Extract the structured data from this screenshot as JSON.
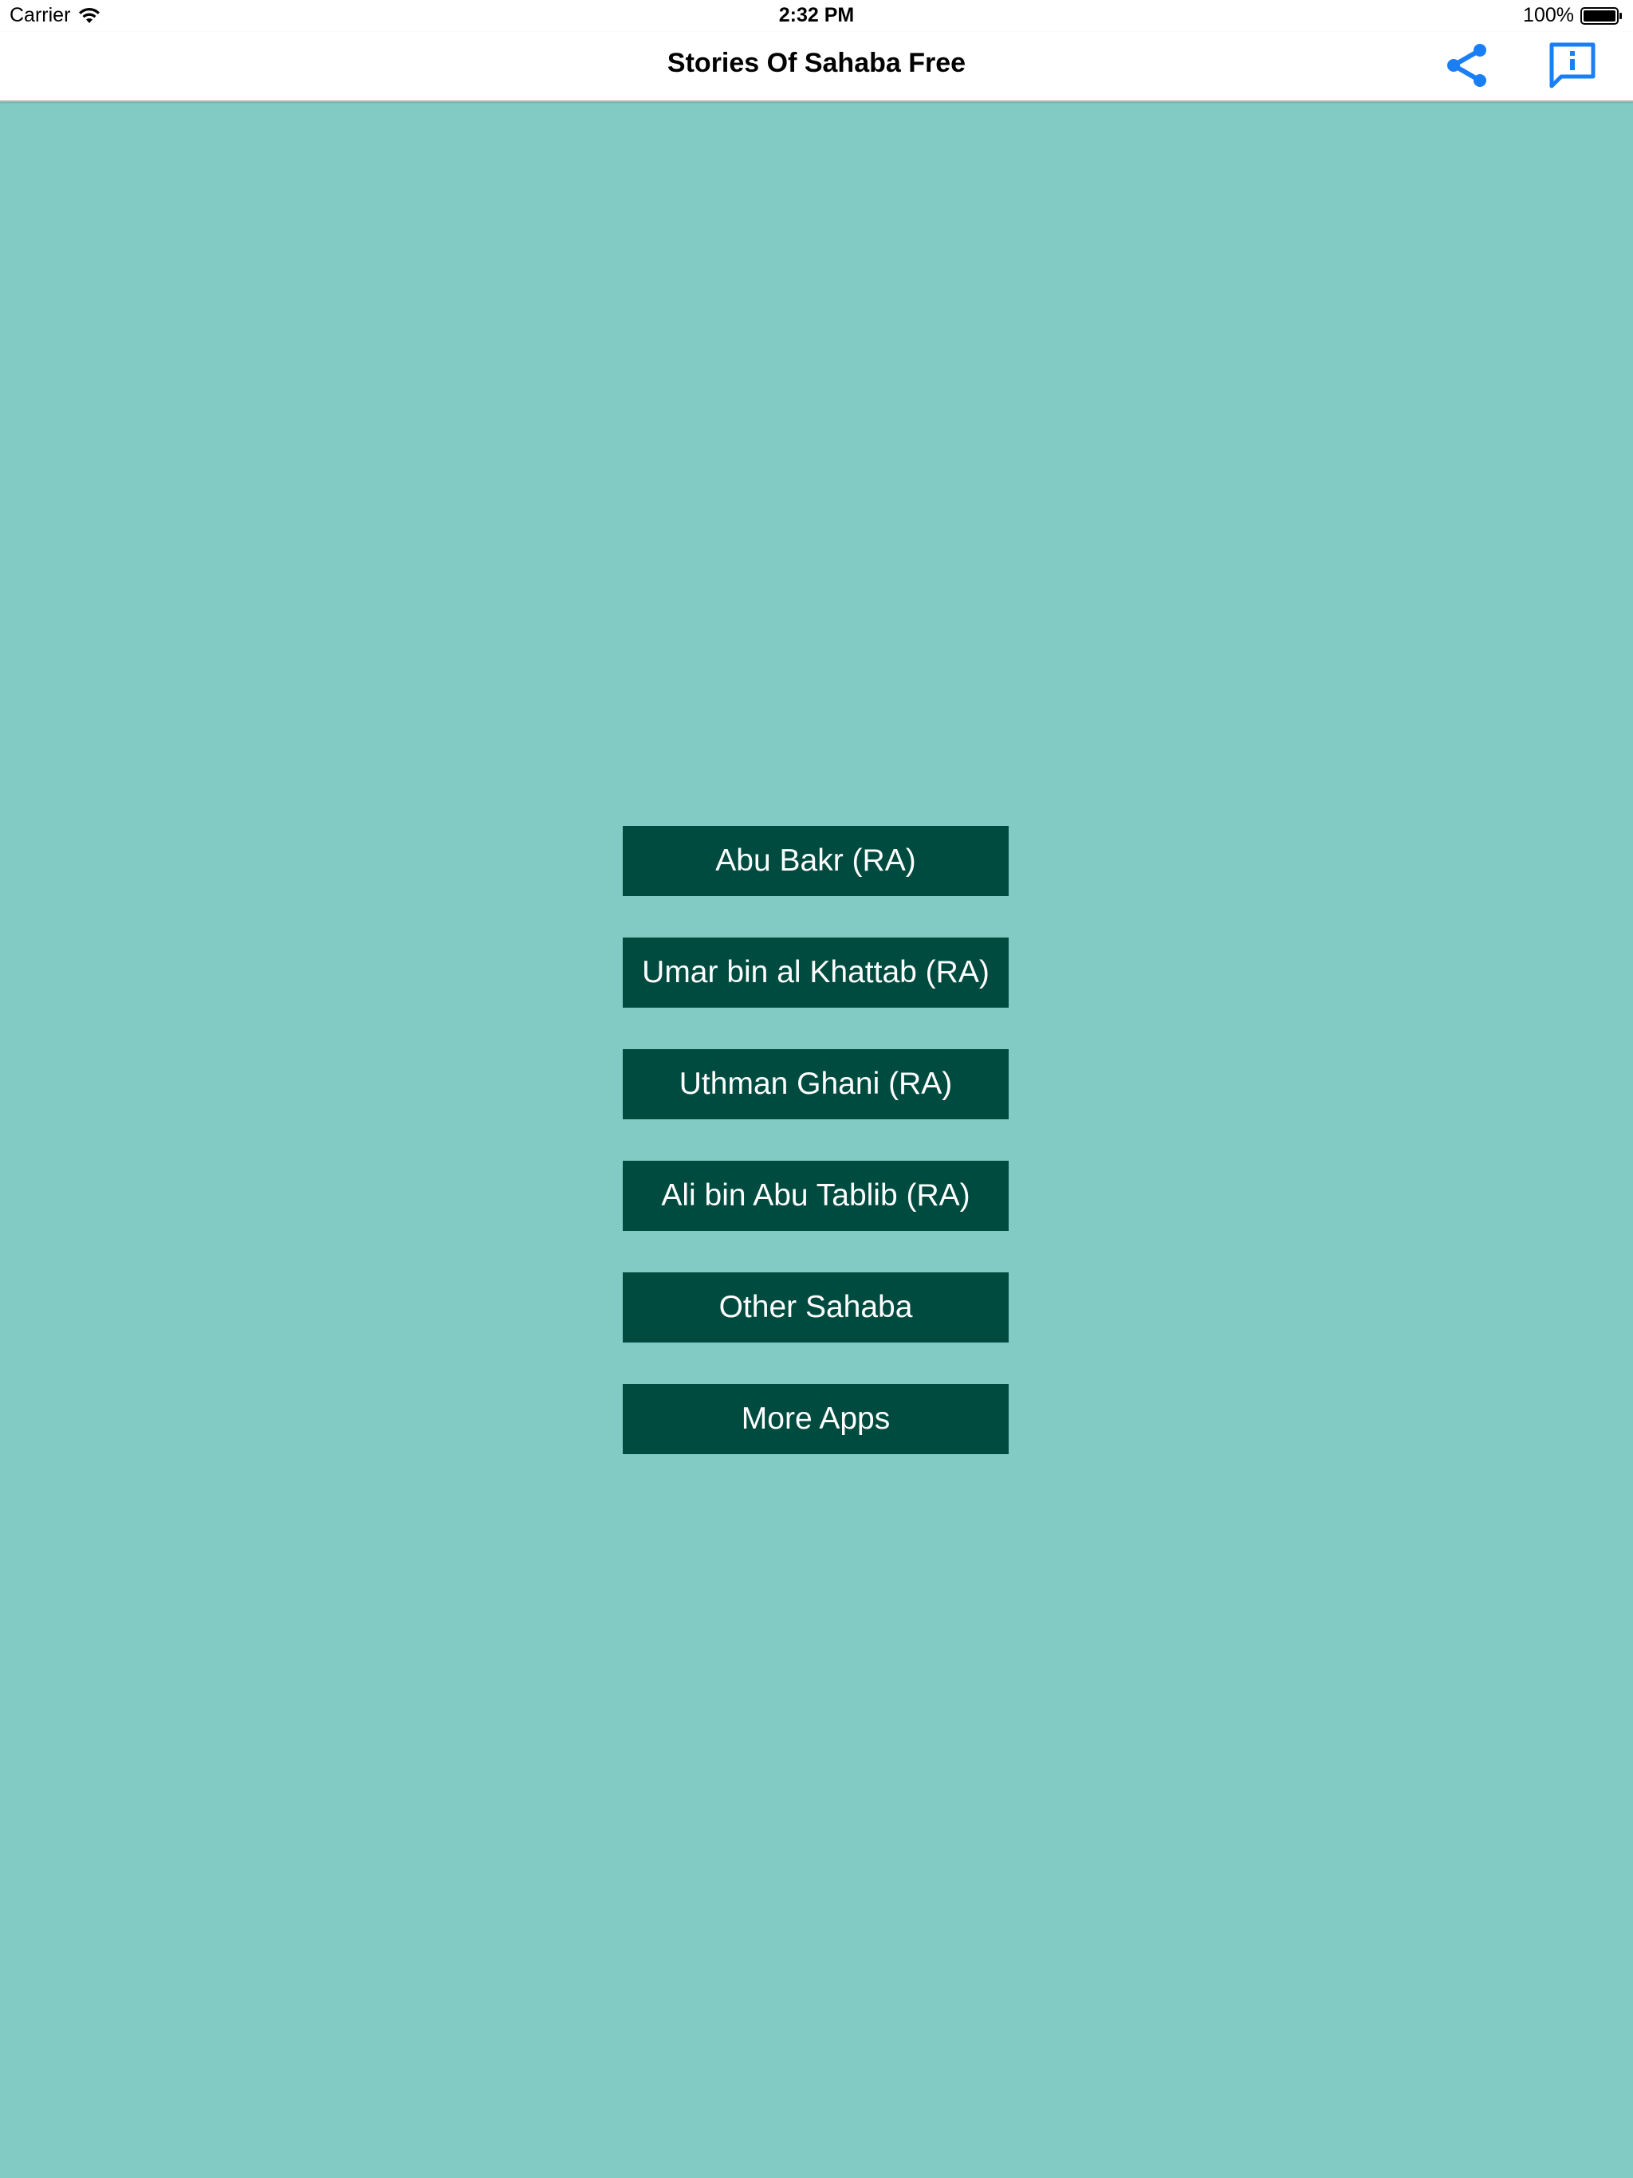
{
  "status_bar": {
    "carrier": "Carrier",
    "time": "2:32 PM",
    "battery": "100%",
    "wifi_icon": "wifi-icon",
    "battery_icon": "battery-icon"
  },
  "nav": {
    "title": "Stories Of Sahaba Free",
    "share_icon": "share-icon",
    "info_icon": "info-icon",
    "accent_color": "#1a7ff5"
  },
  "menu": {
    "items": [
      {
        "label": "Abu Bakr (RA)"
      },
      {
        "label": "Umar bin al Khattab (RA)"
      },
      {
        "label": "Uthman Ghani (RA)"
      },
      {
        "label": "Ali bin Abu Tablib (RA)"
      },
      {
        "label": "Other Sahaba"
      },
      {
        "label": "More Apps"
      }
    ]
  },
  "colors": {
    "background": "#82cbc4",
    "button_bg": "#004b3f",
    "button_text": "#ffffff"
  }
}
